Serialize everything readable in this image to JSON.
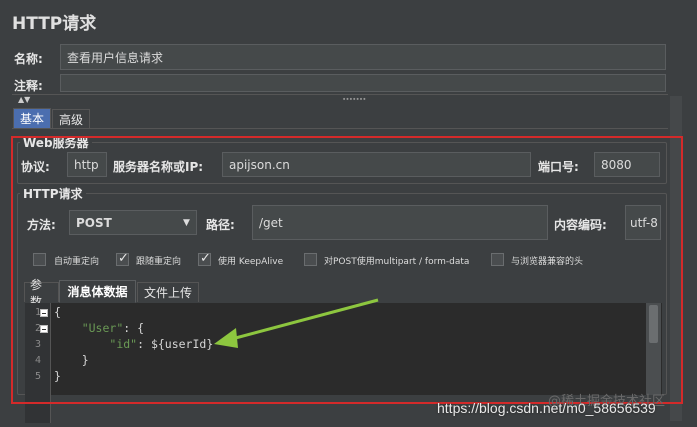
{
  "panel": {
    "title": "HTTP请求"
  },
  "name": {
    "label": "名称:",
    "value": "查看用户信息请求"
  },
  "comment": {
    "label": "注释:",
    "value": ""
  },
  "outer_tabs": [
    {
      "label": "基本"
    },
    {
      "label": "高级"
    }
  ],
  "web_server": {
    "title": "Web服务器",
    "protocol_label": "协议:",
    "protocol_value": "http",
    "server_label": "服务器名称或IP:",
    "server_value": "apijson.cn",
    "port_label": "端口号:",
    "port_value": "8080"
  },
  "http_request": {
    "title": "HTTP请求",
    "method_label": "方法:",
    "method_value": "POST",
    "path_label": "路径:",
    "path_value": "/get",
    "encoding_label": "内容编码:",
    "encoding_value": "utf-8"
  },
  "options": [
    {
      "label": "自动重定向",
      "checked": false
    },
    {
      "label": "跟随重定向",
      "checked": true
    },
    {
      "label": "使用 KeepAlive",
      "checked": true
    },
    {
      "label": "对POST使用multipart / form-data",
      "checked": false
    },
    {
      "label": "与浏览器兼容的头",
      "checked": false
    }
  ],
  "body_tabs": [
    {
      "label": "参数"
    },
    {
      "label": "消息体数据"
    },
    {
      "label": "文件上传"
    }
  ],
  "editor": {
    "line_numbers": [
      "1",
      "2",
      "3",
      "4",
      "5"
    ],
    "lines": [
      {
        "parts": [
          {
            "t": "{",
            "c": ""
          }
        ]
      },
      {
        "parts": [
          {
            "t": "    ",
            "c": ""
          },
          {
            "t": "\"User\"",
            "c": "str"
          },
          {
            "t": ": {",
            "c": ""
          }
        ]
      },
      {
        "parts": [
          {
            "t": "        ",
            "c": ""
          },
          {
            "t": "\"id\"",
            "c": "str"
          },
          {
            "t": ": ${userId}",
            "c": ""
          }
        ]
      },
      {
        "parts": [
          {
            "t": "    }",
            "c": ""
          }
        ]
      },
      {
        "parts": [
          {
            "t": "}",
            "c": ""
          }
        ]
      }
    ]
  },
  "watermark": {
    "text": "https://blog.csdn.net/m0_58656539",
    "ghost": "@稀土掘金技术社区"
  },
  "colors": {
    "highlight_box": "#d42a2a",
    "arrow": "#8dc63f",
    "active_tab": "#4b6eaf"
  }
}
